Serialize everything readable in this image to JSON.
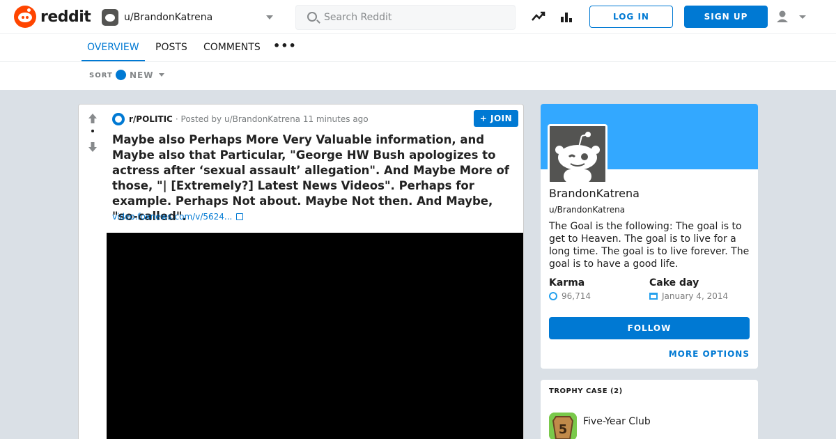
{
  "brand": {
    "name": "reddit",
    "color": "#ff4500"
  },
  "header": {
    "user_dropdown": "u/BrandonKatrena",
    "search_placeholder": "Search Reddit",
    "login_label": "LOG IN",
    "signup_label": "SIGN UP",
    "icons": [
      "trending-icon",
      "popular-icon",
      "user-icon",
      "chevron-down-icon"
    ]
  },
  "tabs": {
    "overview": "OVERVIEW",
    "posts": "POSTS",
    "comments": "COMMENTS",
    "more": "•••",
    "active": "overview"
  },
  "sortbar": {
    "label": "SORT",
    "value": "NEW"
  },
  "post": {
    "subreddit": "r/POLITIC",
    "meta": "· Posted by u/BrandonKatrena 11 minutes ago",
    "join_label": "JOIN",
    "title": "Maybe also Perhaps More Very Valuable information, and Maybe also that Particular, \"George HW Bush apologizes to actress after ‘sexual assault’ allegation\". And Maybe More of those, \"| [Extremely?] Latest News Videos\". Perhaps for example. Perhaps Not about. Maybe Not then. And Maybe, \"so-called\".",
    "link": "video.foxnews.com/v/5624..."
  },
  "profile": {
    "display_name": "BrandonKatrena",
    "handle": "u/BrandonKatrena",
    "bio": "The Goal is the following: The goal is to get to Heaven. The goal is to live for a long time. The goal is to live forever. The goal is to have a good life.",
    "karma_label": "Karma",
    "karma_value": "96,714",
    "cakeday_label": "Cake day",
    "cakeday_value": "January 4, 2014",
    "follow_label": "FOLLOW",
    "more_options_label": "MORE OPTIONS",
    "banner_color": "#33a8ff"
  },
  "trophy_case": {
    "title": "TROPHY CASE (2)",
    "items": [
      {
        "name": "Five-Year Club",
        "icon": "five-year-club-icon"
      }
    ]
  },
  "colors": {
    "accent": "#0079d3",
    "background": "#dae0e6"
  }
}
